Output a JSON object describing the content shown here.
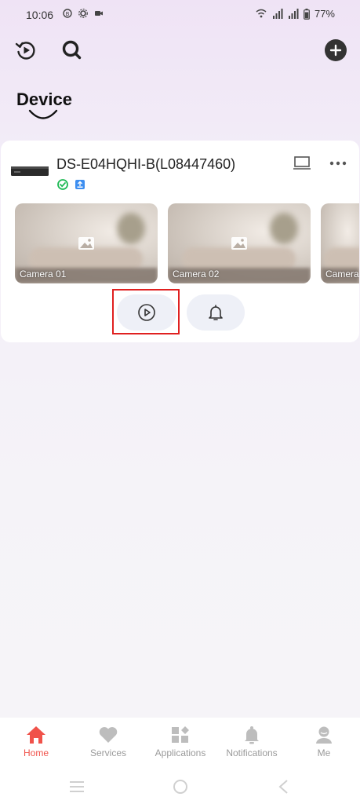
{
  "status_bar": {
    "time": "10:06",
    "battery": "77%"
  },
  "toolbar": {
    "history_icon": "playback-history-icon",
    "search_icon": "search-icon",
    "add_icon": "add-icon"
  },
  "page": {
    "title": "Device"
  },
  "device": {
    "name": "DS-E04HQHI-B(L08447460)",
    "status_badge": "online-check-icon",
    "cameras": [
      {
        "label": "Camera 01"
      },
      {
        "label": "Camera 02"
      },
      {
        "label": "Camera"
      }
    ]
  },
  "tabs": [
    {
      "label": "Home",
      "icon": "home-icon",
      "active": true
    },
    {
      "label": "Services",
      "icon": "heart-icon",
      "active": false
    },
    {
      "label": "Applications",
      "icon": "apps-icon",
      "active": false
    },
    {
      "label": "Notifications",
      "icon": "bell-icon",
      "active": false
    },
    {
      "label": "Me",
      "icon": "user-icon",
      "active": false
    }
  ],
  "colors": {
    "accent": "#f0524a",
    "highlight_box": "#e02020",
    "online_green": "#1db954"
  }
}
